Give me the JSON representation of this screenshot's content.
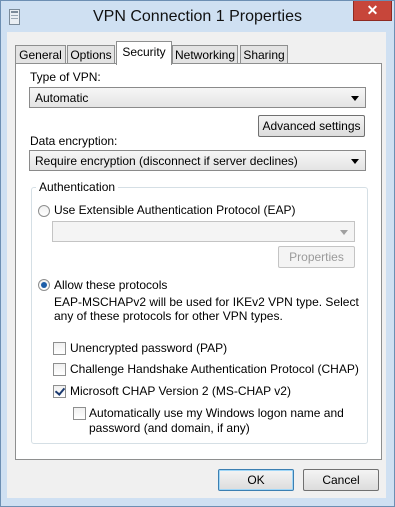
{
  "window": {
    "title": "VPN Connection 1 Properties",
    "close_glyph": "✕"
  },
  "tabs": [
    {
      "label": "General"
    },
    {
      "label": "Options"
    },
    {
      "label": "Security"
    },
    {
      "label": "Networking"
    },
    {
      "label": "Sharing"
    }
  ],
  "active_tab": "Security",
  "vpn_type": {
    "label": "Type of VPN:",
    "value": "Automatic"
  },
  "advanced_settings": {
    "label": "Advanced settings"
  },
  "data_encryption": {
    "label": "Data encryption:",
    "value": "Require encryption (disconnect if server declines)"
  },
  "authentication": {
    "legend": "Authentication",
    "eap": {
      "label": "Use Extensible Authentication Protocol (EAP)",
      "selected": false,
      "combo_value": ""
    },
    "properties_button": "Properties",
    "allow": {
      "label": "Allow these protocols",
      "selected": true
    },
    "description_line1": "EAP-MSCHAPv2 will be used for IKEv2 VPN type. Select",
    "description_line2": "any of these protocols for other VPN types.",
    "protocols": [
      {
        "label": "Unencrypted password (PAP)",
        "checked": false
      },
      {
        "label": "Challenge Handshake Authentication Protocol (CHAP)",
        "checked": false
      },
      {
        "label": "Microsoft CHAP Version 2 (MS-CHAP v2)",
        "checked": true
      }
    ],
    "auto_logon": {
      "line1": "Automatically use my Windows logon name and",
      "line2": "password (and domain, if any)",
      "checked": false
    }
  },
  "buttons": {
    "ok": "OK",
    "cancel": "Cancel"
  },
  "colors": {
    "frame": "#cfe0f2",
    "close": "#c7463a",
    "radio_dot": "#1c5da8"
  }
}
